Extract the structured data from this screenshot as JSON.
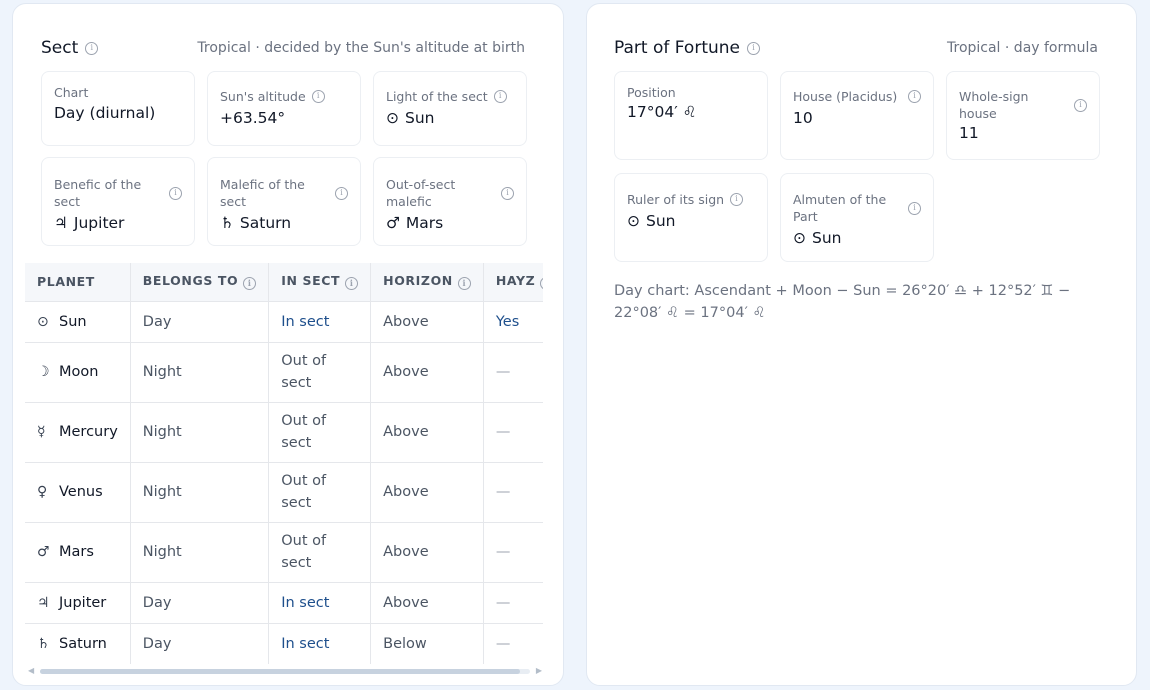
{
  "sect": {
    "title": "Sect",
    "subtitle": "Tropical · decided by the Sun's altitude at birth",
    "cards": [
      {
        "label": "Chart",
        "value": "Day (diurnal)",
        "glyph": ""
      },
      {
        "label": "Sun's altitude",
        "value": "+63.54°",
        "glyph": ""
      },
      {
        "label": "Light of the sect",
        "value": "Sun",
        "glyph": "⊙"
      },
      {
        "label": "Benefic of the sect",
        "value": "Jupiter",
        "glyph": "♃"
      },
      {
        "label": "Malefic of the sect",
        "value": "Saturn",
        "glyph": "♄"
      },
      {
        "label": "Out-of-sect malefic",
        "value": "Mars",
        "glyph": "♂"
      }
    ],
    "table": {
      "headers": [
        "PLANET",
        "BELONGS TO",
        "IN SECT",
        "HORIZON",
        "HAYZ"
      ],
      "rows": [
        {
          "glyph": "⊙",
          "planet": "Sun",
          "belongs": "Day",
          "in_sect": "In sect",
          "horizon": "Above",
          "hayz": "Yes"
        },
        {
          "glyph": "☽",
          "planet": "Moon",
          "belongs": "Night",
          "in_sect": "Out of sect",
          "horizon": "Above",
          "hayz": "—"
        },
        {
          "glyph": "☿",
          "planet": "Mercury",
          "belongs": "Night",
          "in_sect": "Out of sect",
          "horizon": "Above",
          "hayz": "—"
        },
        {
          "glyph": "♀",
          "planet": "Venus",
          "belongs": "Night",
          "in_sect": "Out of sect",
          "horizon": "Above",
          "hayz": "—"
        },
        {
          "glyph": "♂",
          "planet": "Mars",
          "belongs": "Night",
          "in_sect": "Out of sect",
          "horizon": "Above",
          "hayz": "—"
        },
        {
          "glyph": "♃",
          "planet": "Jupiter",
          "belongs": "Day",
          "in_sect": "In sect",
          "horizon": "Above",
          "hayz": "—"
        },
        {
          "glyph": "♄",
          "planet": "Saturn",
          "belongs": "Day",
          "in_sect": "In sect",
          "horizon": "Below",
          "hayz": "—"
        }
      ]
    }
  },
  "pof": {
    "title": "Part of Fortune",
    "subtitle": "Tropical · day formula",
    "cards": [
      {
        "label": "Position",
        "value": "17°04′ ♌",
        "glyph": ""
      },
      {
        "label": "House (Placidus)",
        "value": "10",
        "glyph": ""
      },
      {
        "label": "Whole-sign house",
        "value": "11",
        "glyph": ""
      },
      {
        "label": "Ruler of its sign",
        "value": "Sun",
        "glyph": "⊙"
      },
      {
        "label": "Almuten of the Part",
        "value": "Sun",
        "glyph": "⊙"
      }
    ],
    "formula": "Day chart: Ascendant + Moon − Sun = 26°20′ ♎ + 12°52′ ♊ − 22°08′ ♌ = 17°04′ ♌"
  },
  "colors": {
    "accent": "#1e4f8c",
    "page_bg": "#eef4fc"
  }
}
